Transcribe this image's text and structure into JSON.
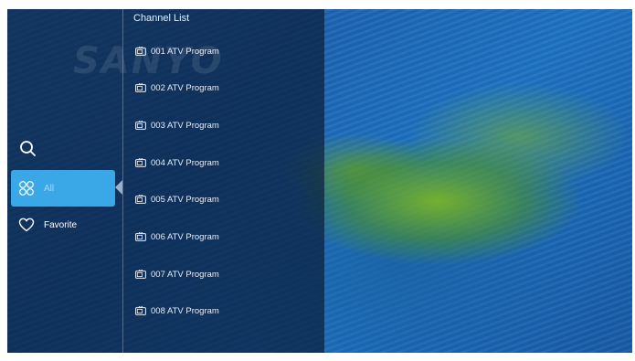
{
  "overlay": {
    "brand_logo": "SANYO"
  },
  "menu": {
    "search_icon": "search-icon",
    "items": [
      {
        "label": "All",
        "icon": "all-apps-icon",
        "active": true
      },
      {
        "label": "Favorite",
        "icon": "heart-icon",
        "active": false
      }
    ]
  },
  "channel_list": {
    "title": "Channel List",
    "items": [
      {
        "label": "001 ATV Program",
        "icon": "tv-icon"
      },
      {
        "label": "002 ATV Program",
        "icon": "tv-icon"
      },
      {
        "label": "003 ATV Program",
        "icon": "tv-icon"
      },
      {
        "label": "004 ATV Program",
        "icon": "tv-icon"
      },
      {
        "label": "005 ATV Program",
        "icon": "tv-icon"
      },
      {
        "label": "006 ATV Program",
        "icon": "tv-icon"
      },
      {
        "label": "007 ATV Program",
        "icon": "tv-icon"
      },
      {
        "label": "008 ATV Program",
        "icon": "tv-icon"
      }
    ]
  },
  "colors": {
    "active_item": "#3aa8e6",
    "overlay": "#0a1e3c"
  }
}
